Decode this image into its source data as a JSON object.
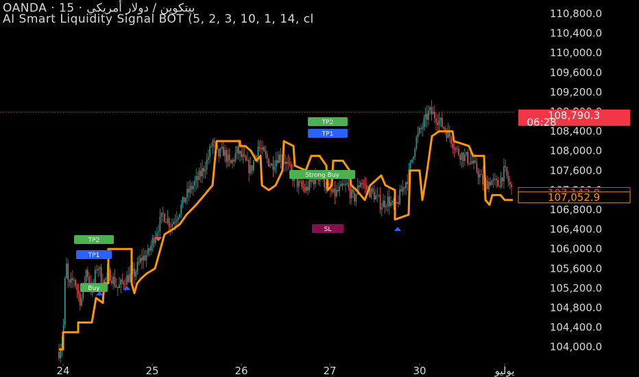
{
  "header": {
    "line1": "OANDA · 15 · بيتكوين / دولار أمريكي",
    "line2": "AI Smart Liquidity Signal BOT  (5, 2, 3, 10, 1, 14, cl"
  },
  "price_box": {
    "price": "108,790.3",
    "countdown": "06:28",
    "color": "#f23645"
  },
  "level_labels": [
    {
      "text": "107,142.9",
      "color": "#f23645"
    },
    {
      "text": "107,052.9",
      "color": "#ff9800"
    }
  ],
  "colors": {
    "up": "#26a69a",
    "down": "#ef5350",
    "trail": "#ff9800",
    "tp_green": "#4caf50",
    "tp_blue": "#2962ff",
    "sl": "#880e4f"
  },
  "chart_data": {
    "type": "candlestick",
    "symbol": "OANDA · 15",
    "x_ticks": [
      "24",
      "25",
      "26",
      "27",
      "30",
      "يوليو"
    ],
    "y_ticks": [
      110800,
      110400,
      110000,
      109600,
      109200,
      108800,
      108400,
      108000,
      107600,
      107200,
      106800,
      106400,
      106000,
      105600,
      105200,
      104800,
      104400,
      104000
    ],
    "ylim": [
      103800,
      111200
    ],
    "last_price": 108790.3,
    "levels": [
      107142.9,
      107052.9
    ],
    "trail_line_key": [
      {
        "x": 0.0,
        "y": 103950
      },
      {
        "x": 0.03,
        "y": 104300
      },
      {
        "x": 0.07,
        "y": 104500
      },
      {
        "x": 0.1,
        "y": 105100
      },
      {
        "x": 0.15,
        "y": 105300
      },
      {
        "x": 0.22,
        "y": 105700
      },
      {
        "x": 0.3,
        "y": 106500
      },
      {
        "x": 0.37,
        "y": 107300
      },
      {
        "x": 0.4,
        "y": 108200
      },
      {
        "x": 0.44,
        "y": 107900
      },
      {
        "x": 0.48,
        "y": 107300
      },
      {
        "x": 0.52,
        "y": 107800
      },
      {
        "x": 0.58,
        "y": 107200
      },
      {
        "x": 0.62,
        "y": 106900
      },
      {
        "x": 0.68,
        "y": 107400
      },
      {
        "x": 0.72,
        "y": 108900
      },
      {
        "x": 0.76,
        "y": 108200
      },
      {
        "x": 0.82,
        "y": 107500
      },
      {
        "x": 0.86,
        "y": 107000
      },
      {
        "x": 0.9,
        "y": 107300
      }
    ],
    "signals": [
      {
        "type": "TP2",
        "text": "TP2",
        "day": "24"
      },
      {
        "type": "TP1",
        "text": "TP1",
        "day": "24"
      },
      {
        "type": "Buy",
        "text": "Buy",
        "day": "24"
      },
      {
        "type": "TP2",
        "text": "TP2",
        "day": "27"
      },
      {
        "type": "TP1",
        "text": "TP1",
        "day": "27"
      },
      {
        "type": "Strong Buy",
        "text": "Strong Buy",
        "day": "27"
      },
      {
        "type": "SL",
        "text": "SL",
        "day": "27"
      }
    ]
  }
}
